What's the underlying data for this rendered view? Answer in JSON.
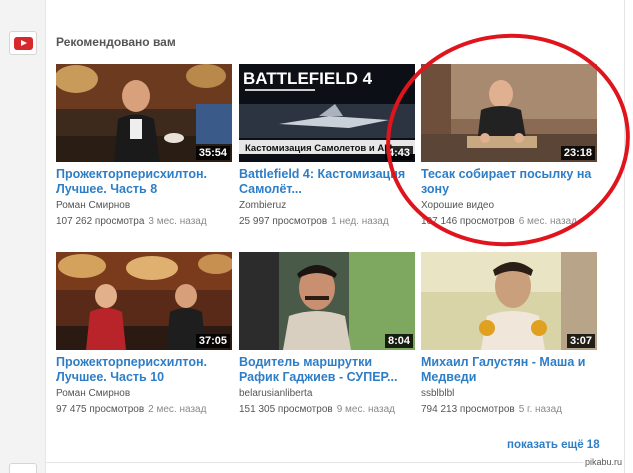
{
  "section": {
    "title": "Рекомендовано вам",
    "icon": "youtube-play-icon"
  },
  "videos": [
    {
      "title": "Прожекторперисхилтон. Лучшее. Часть 8",
      "channel": "Роман Смирнов",
      "views": "107 262 просмотра",
      "age": "3 мес. назад",
      "duration": "35:54"
    },
    {
      "title": "Battlefield 4: Кастомизация Самолёт...",
      "channel": "Zombieruz",
      "views": "25 997 просмотров",
      "age": "1 нед. назад",
      "duration": "4:43",
      "thumb_text": {
        "brand": "BATTLEFIELD 4",
        "caption": "Кастомизация Самолетов и АМ..."
      }
    },
    {
      "title": "Тесак собирает посылку на зону",
      "channel": "Хорошие видео",
      "views": "107 146 просмотров",
      "age": "6 мес. назад",
      "duration": "23:18"
    },
    {
      "title": "Прожекторперисхилтон. Лучшее. Часть 10",
      "channel": "Роман Смирнов",
      "views": "97 475 просмотров",
      "age": "2 мес. назад",
      "duration": "37:05"
    },
    {
      "title": "Водитель маршрутки Рафик Гаджиев - СУПЕР...",
      "channel": "belarusianliberta",
      "views": "151 305 просмотров",
      "age": "9 мес. назад",
      "duration": "8:04"
    },
    {
      "title": "Михаил Галустян - Маша и Медведи",
      "channel": "ssblblbl",
      "views": "794 213 просмотров",
      "age": "5 г. назад",
      "duration": "3:07"
    }
  ],
  "show_more": "показать ещё 18",
  "watermark": "pikabu.ru",
  "colors": {
    "link": "#2d7ec7",
    "annotation": "#e0141c",
    "icon": "#d9282c"
  }
}
